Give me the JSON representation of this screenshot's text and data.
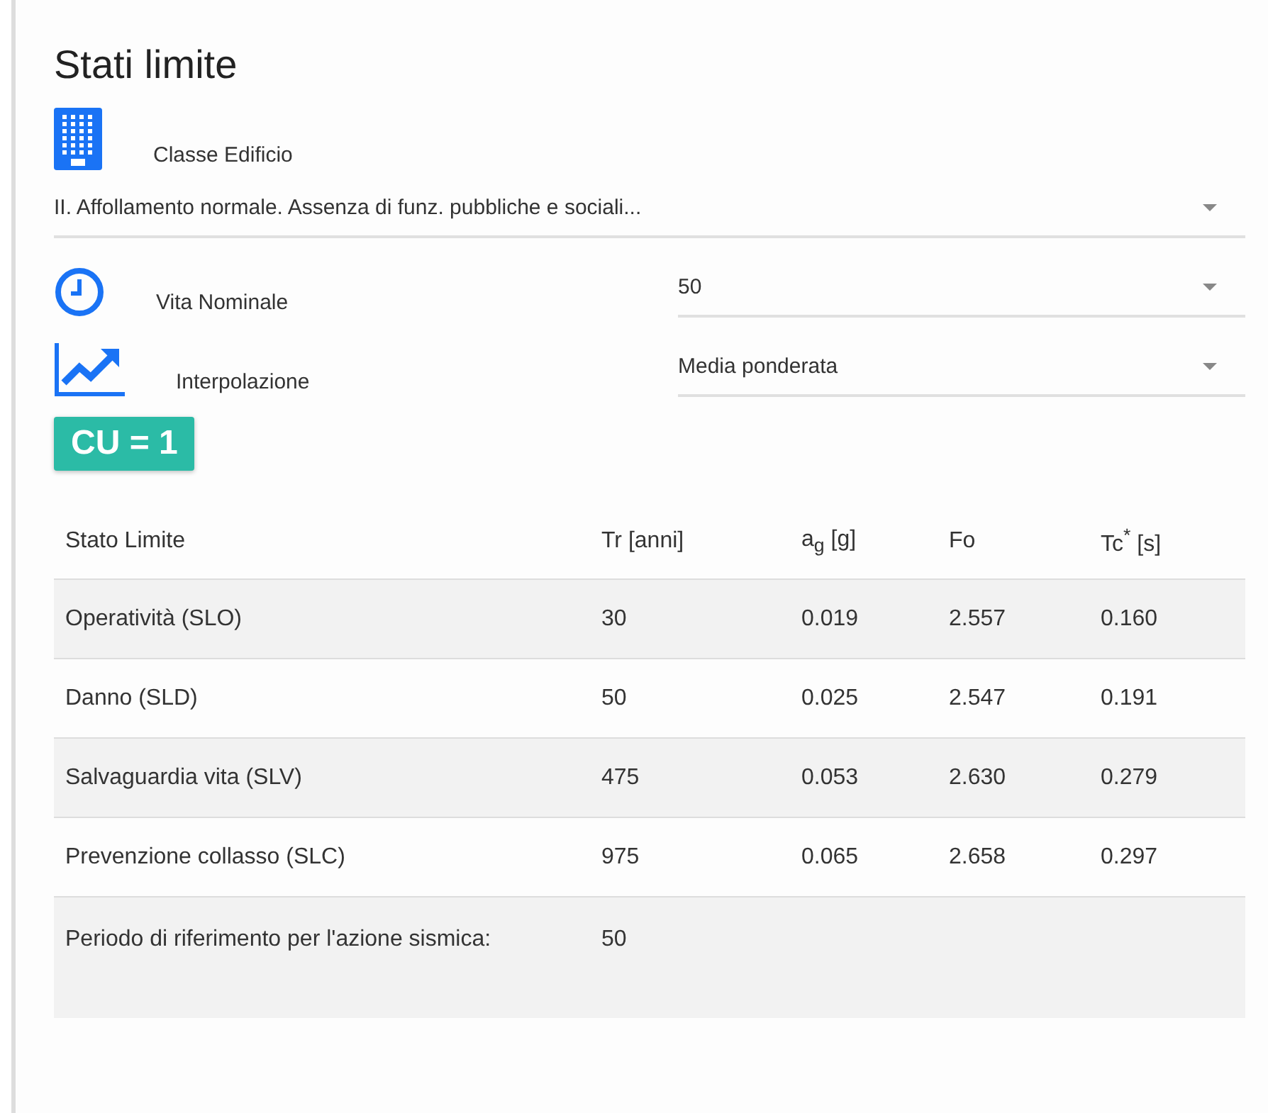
{
  "title": "Stati limite",
  "building_class": {
    "label": "Classe Edificio",
    "value": "II. Affollamento normale. Assenza di funz. pubbliche e sociali..."
  },
  "nominal_life": {
    "label": "Vita Nominale",
    "value": "50"
  },
  "interpolation": {
    "label": "Interpolazione",
    "value": "Media ponderata"
  },
  "badge": "CU = 1",
  "table": {
    "columns": [
      "Stato Limite",
      "Tr [anni]",
      "a$_{g}$ [g]",
      "Fo",
      "Tc$^{*}$ [s]"
    ],
    "rows": [
      [
        "Operatività (SLO)",
        "30",
        "0.019",
        "2.557",
        "0.160"
      ],
      [
        "Danno (SLD)",
        "50",
        "0.025",
        "2.547",
        "0.191"
      ],
      [
        "Salvaguardia vita (SLV)",
        "475",
        "0.053",
        "2.630",
        "0.279"
      ],
      [
        "Prevenzione collasso (SLC)",
        "975",
        "0.065",
        "2.658",
        "0.297"
      ],
      [
        "Periodo di riferimento per l'azione sismica:",
        "50"
      ]
    ]
  }
}
